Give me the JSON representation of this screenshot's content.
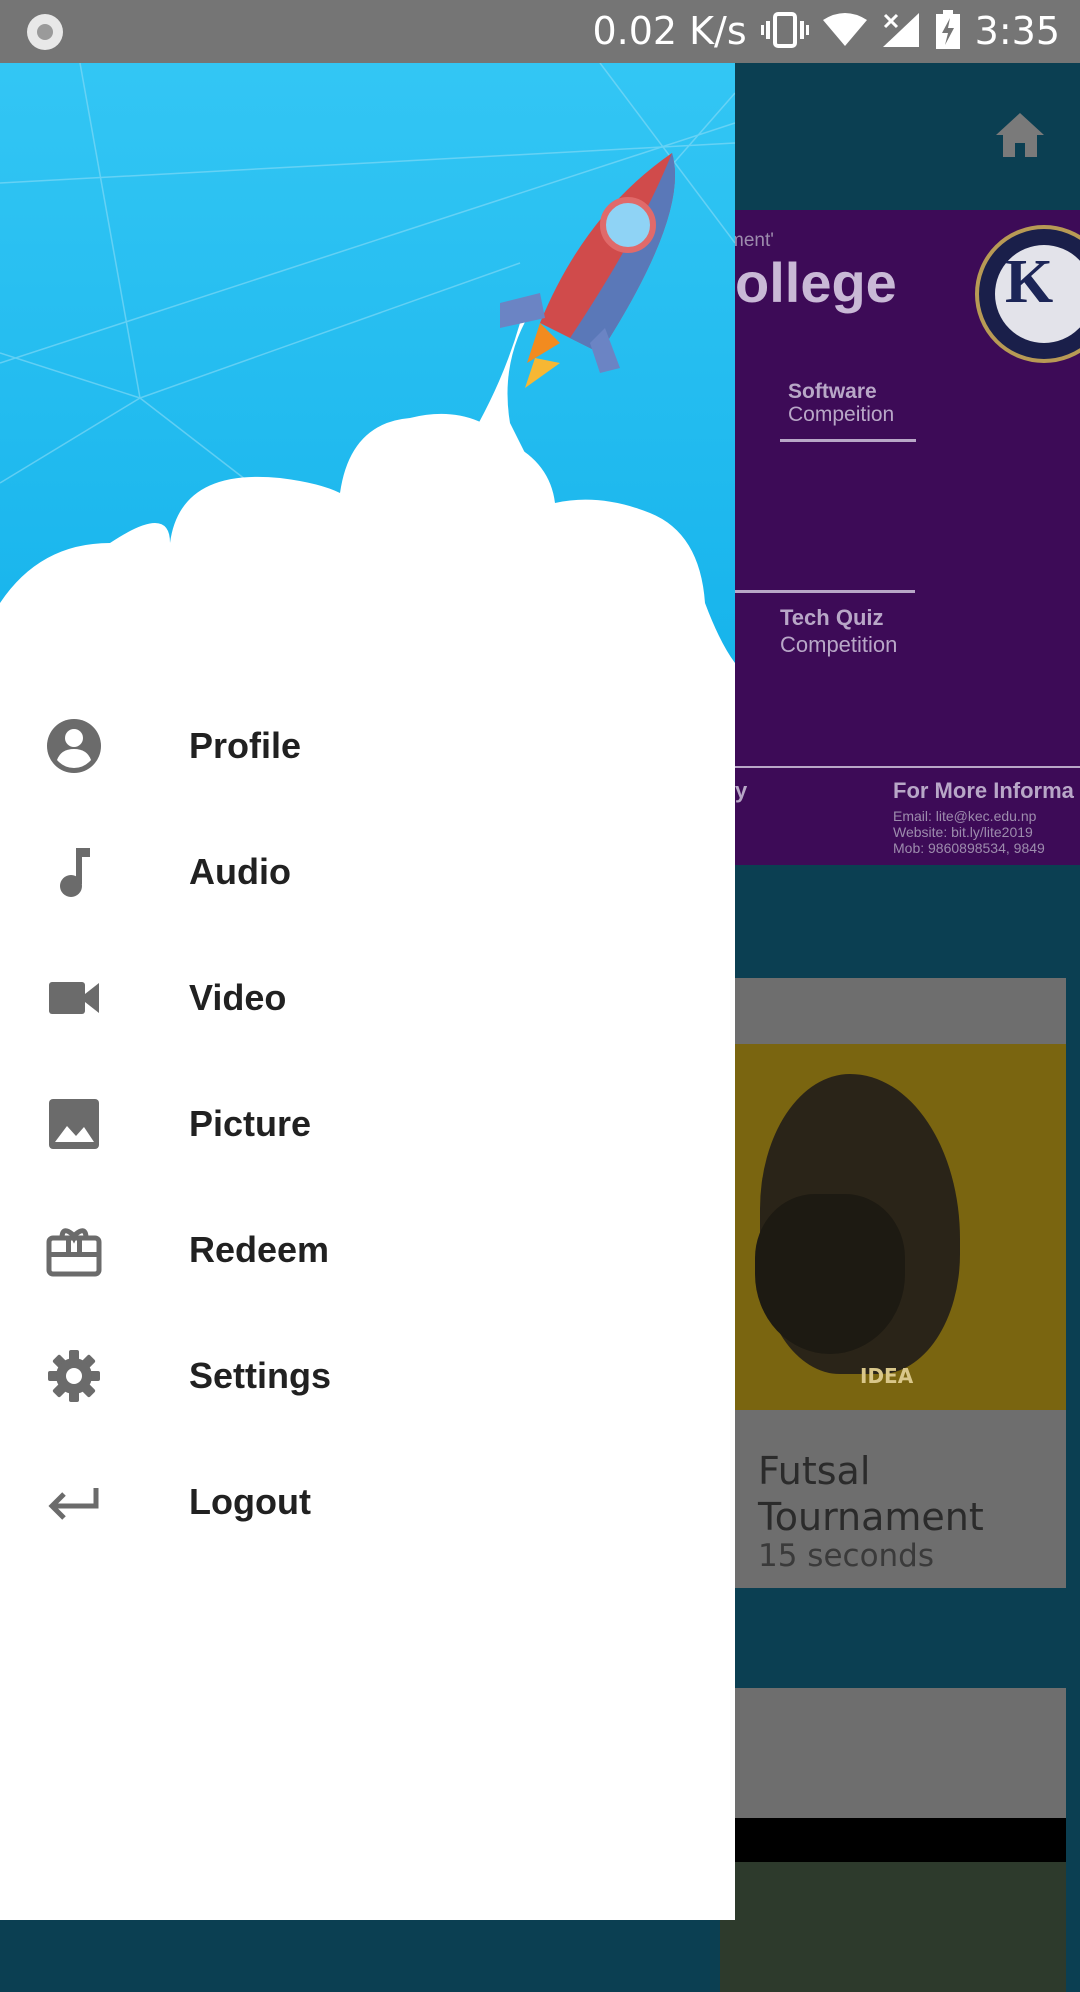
{
  "status_bar": {
    "net_speed": "0.02 K/s",
    "time": "3:35",
    "icons": [
      "record-icon",
      "vibrate-icon",
      "wifi-icon",
      "signal-icon",
      "battery-charging-icon"
    ]
  },
  "drawer": {
    "header_image": "rocket-launch-illustration",
    "menu": [
      {
        "label": "Profile",
        "icon": "account-circle-icon"
      },
      {
        "label": "Audio",
        "icon": "music-note-icon"
      },
      {
        "label": "Video",
        "icon": "videocam-icon"
      },
      {
        "label": "Picture",
        "icon": "image-icon"
      },
      {
        "label": "Redeem",
        "icon": "gift-card-icon"
      },
      {
        "label": "Settings",
        "icon": "settings-gear-icon"
      },
      {
        "label": "Logout",
        "icon": "logout-arrow-icon"
      }
    ]
  },
  "background_app": {
    "toolbar_icon": "home-icon",
    "banner": {
      "tag": "ment'",
      "college": "ollege",
      "item1": "Software",
      "item1b": "Compeition",
      "item2": "Tech Quiz",
      "item2b": "Competition",
      "left_bottom": "y",
      "more_info": "For More Informa",
      "email": "Email: lite@kec.edu.np",
      "website": "Website: bit.ly/lite2019",
      "mob": "Mob: 9860898534, 9849"
    },
    "card": {
      "image_caption": "IDEA",
      "title": "Futsal Tournament",
      "subtitle": "15 seconds"
    }
  },
  "colors": {
    "sky": "#2ec3f2",
    "status_bar": "#757575",
    "toolbar": "#0b3f52",
    "banner": "#3d0b57",
    "menu_text": "#212121",
    "menu_icon": "#6b6b6b"
  }
}
